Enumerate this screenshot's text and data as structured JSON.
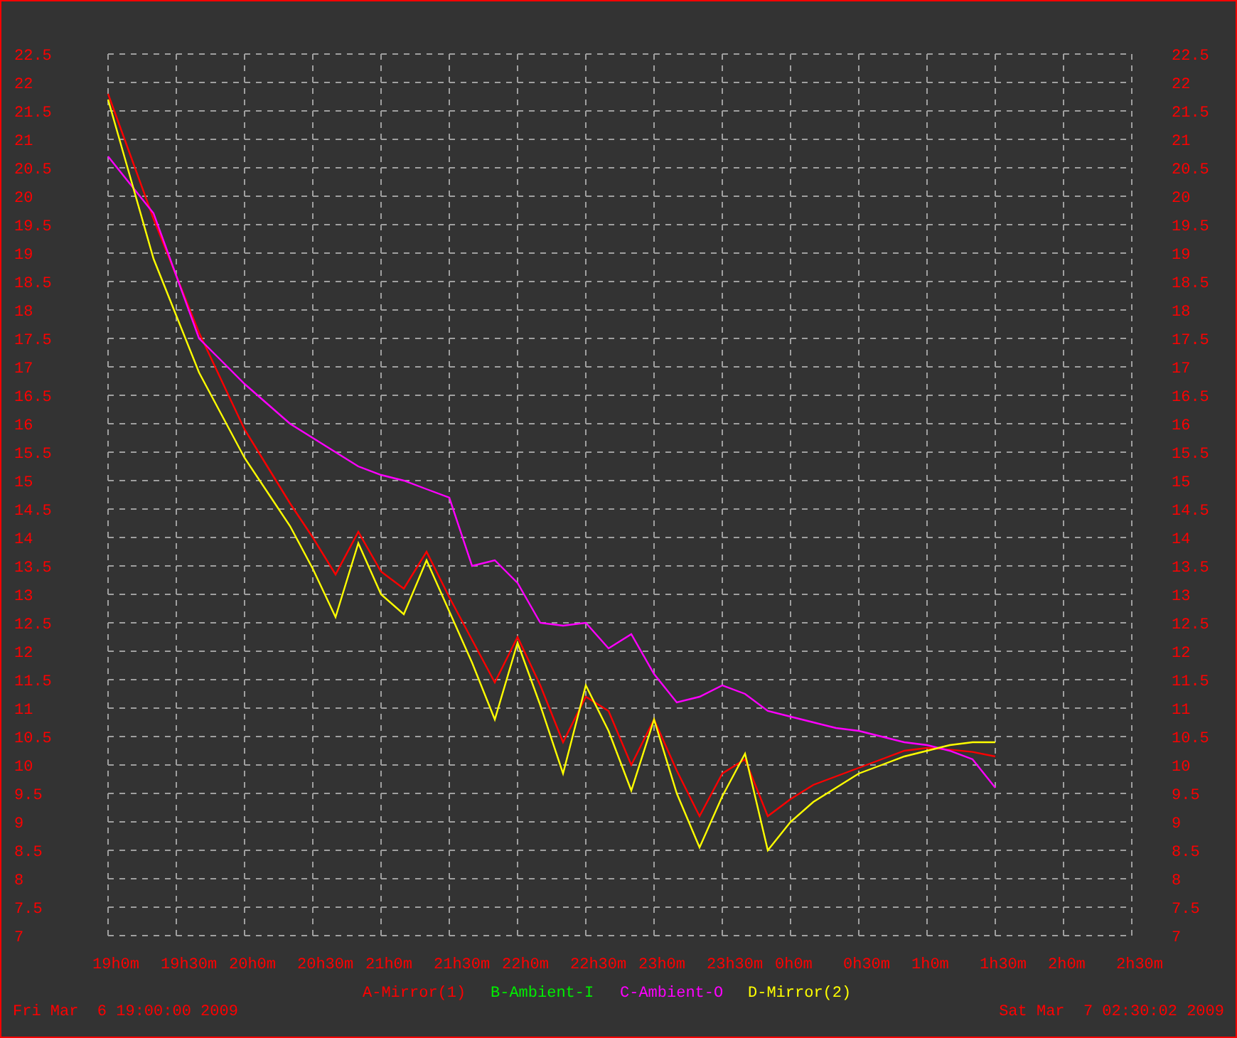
{
  "chart_data": {
    "type": "line",
    "categories": [
      "19h0m",
      null,
      null,
      "19h30m",
      null,
      null,
      "20h0m",
      null,
      null,
      "20h30m",
      null,
      null,
      "21h0m",
      null,
      null,
      "21h30m",
      null,
      null,
      "22h0m",
      null,
      null,
      "22h30m",
      null,
      null,
      "23h0m",
      null,
      null,
      "23h30m",
      null,
      null,
      "0h0m",
      null,
      null,
      "0h30m",
      null,
      null,
      "1h0m",
      null,
      null,
      "1h30m",
      null,
      null,
      "2h0m",
      null,
      null,
      "2h30m"
    ],
    "series": [
      {
        "name": "A-Mirror(1)",
        "color": "#ff0000",
        "values": [
          21.8,
          20.7,
          19.6,
          18.6,
          17.6,
          16.75,
          15.9,
          15.25,
          14.6,
          14.0,
          13.35,
          14.1,
          13.4,
          13.1,
          13.75,
          12.95,
          12.2,
          11.45,
          12.25,
          11.4,
          10.4,
          11.2,
          10.95,
          10.0,
          10.8,
          9.9,
          9.1,
          9.85,
          10.1,
          9.1,
          9.4,
          9.65,
          9.8,
          9.95,
          10.1,
          10.25,
          10.3,
          10.27,
          10.23,
          10.15,
          null,
          null,
          null,
          null,
          null,
          null
        ]
      },
      {
        "name": "B-Ambient-I",
        "color": "#00ee00",
        "values": [
          null,
          null,
          null,
          null,
          null,
          null,
          null,
          null,
          null,
          null,
          null,
          null,
          null,
          null,
          null,
          null,
          null,
          null,
          null,
          null,
          null,
          null,
          null,
          null,
          null,
          null,
          null,
          null,
          null,
          null,
          null,
          null,
          null,
          null,
          null,
          null,
          null,
          null,
          null,
          null,
          null,
          null,
          null,
          null,
          null,
          null
        ]
      },
      {
        "name": "C-Ambient-O",
        "color": "#ff00ff",
        "values": [
          20.7,
          20.2,
          19.7,
          18.6,
          17.5,
          17.1,
          16.7,
          16.35,
          16.0,
          15.75,
          15.5,
          15.25,
          15.1,
          15.0,
          14.85,
          14.7,
          13.5,
          13.6,
          13.2,
          12.5,
          12.45,
          12.5,
          12.05,
          12.3,
          11.6,
          11.1,
          11.2,
          11.4,
          11.25,
          10.95,
          10.85,
          10.75,
          10.65,
          10.6,
          10.5,
          10.4,
          10.35,
          10.25,
          10.1,
          9.6,
          null,
          null,
          null,
          null,
          null,
          null
        ]
      },
      {
        "name": "D-Mirror(2)",
        "color": "#ffff00",
        "values": [
          21.7,
          20.3,
          18.9,
          17.9,
          16.9,
          16.15,
          15.4,
          14.8,
          14.2,
          13.45,
          12.6,
          13.9,
          13.0,
          12.65,
          13.6,
          12.7,
          11.8,
          10.8,
          12.15,
          11.05,
          9.85,
          11.4,
          10.6,
          9.55,
          10.8,
          9.5,
          8.55,
          9.45,
          10.2,
          8.5,
          9.0,
          9.35,
          9.6,
          9.85,
          10.0,
          10.15,
          10.25,
          10.35,
          10.4,
          10.4,
          null,
          null,
          null,
          null,
          null,
          null
        ]
      }
    ],
    "grid": true,
    "ylim": [
      7,
      22.5
    ],
    "yticks": [
      {
        "value": 22.5,
        "label": "22.5"
      },
      {
        "value": 22,
        "label": "22"
      },
      {
        "value": 21.5,
        "label": "21.5"
      },
      {
        "value": 21,
        "label": "21"
      },
      {
        "value": 20.5,
        "label": "20.5"
      },
      {
        "value": 20,
        "label": "20"
      },
      {
        "value": 19.5,
        "label": "19.5"
      },
      {
        "value": 19,
        "label": "19"
      },
      {
        "value": 18.5,
        "label": "18.5"
      },
      {
        "value": 18,
        "label": "18"
      },
      {
        "value": 17.5,
        "label": "17.5"
      },
      {
        "value": 17,
        "label": "17"
      },
      {
        "value": 16.5,
        "label": "16.5"
      },
      {
        "value": 16,
        "label": "16"
      },
      {
        "value": 15.5,
        "label": "15.5"
      },
      {
        "value": 15,
        "label": "15"
      },
      {
        "value": 14.5,
        "label": "14.5"
      },
      {
        "value": 14,
        "label": "14"
      },
      {
        "value": 13.5,
        "label": "13.5"
      },
      {
        "value": 13,
        "label": "13"
      },
      {
        "value": 12.5,
        "label": "12.5"
      },
      {
        "value": 12,
        "label": "12"
      },
      {
        "value": 11.5,
        "label": "11.5"
      },
      {
        "value": 11,
        "label": "11"
      },
      {
        "value": 10.5,
        "label": "10.5"
      },
      {
        "value": 10,
        "label": "10"
      },
      {
        "value": 9.5,
        "label": "9.5"
      },
      {
        "value": 9,
        "label": "9"
      },
      {
        "value": 8.5,
        "label": "8.5"
      },
      {
        "value": 8,
        "label": "8"
      },
      {
        "value": 7.5,
        "label": "7.5"
      },
      {
        "value": 7,
        "label": "7"
      }
    ]
  },
  "right_axis_labels": [
    "22.5",
    "22",
    "21.5",
    "21",
    "20.5",
    "20",
    "19.5",
    "19",
    "18.5",
    "18",
    "17.5",
    "17",
    "16.5",
    "16",
    "15.5",
    "15",
    "14.5",
    "14",
    "13.5",
    "13",
    "12.5",
    "12",
    "11.5",
    "11",
    "10.5",
    "10",
    "9.5",
    "9",
    "8.5",
    "8",
    "7.5",
    "7"
  ],
  "footer": {
    "start": "Fri Mar  6 19:00:00 2009",
    "end": "Sat Mar  7 02:30:02 2009"
  }
}
